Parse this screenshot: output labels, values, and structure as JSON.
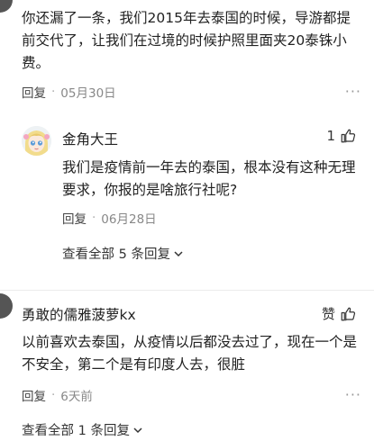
{
  "comments": [
    {
      "text": "你还漏了一条，我们2015年去泰国的时候，导游都提前交代了，让我们在过境的时候护照里面夹20泰铢小费。",
      "reply_label": "回复",
      "separator": "·",
      "date": "05月30日",
      "more": "···",
      "sub_reply": {
        "username": "金角大王",
        "like_count": "1",
        "text": "我们是疫情前一年去的泰国，根本没有这种无理要求，你报的是啥旅行社呢?",
        "reply_label": "回复",
        "separator": "·",
        "date": "06月28日"
      },
      "view_all": "查看全部 5 条回复"
    },
    {
      "username": "勇敢的儒雅菠萝kx",
      "like_label": "赞",
      "text": "以前喜欢去泰国，从疫情以后都没去过了，现在一个是不安全，第二个是有印度人去，很脏",
      "reply_label": "回复",
      "separator": "·",
      "date": "6天前",
      "more": "···",
      "view_all": "查看全部 1 条回复"
    }
  ]
}
